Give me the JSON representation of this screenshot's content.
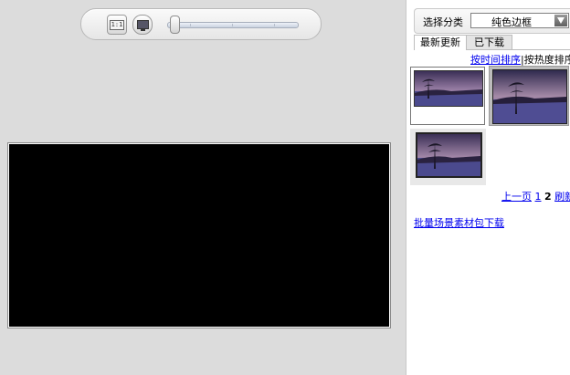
{
  "toolbar": {
    "actual_size_label": "1:1",
    "zoom_level": 0.05
  },
  "panel": {
    "category_label": "选择分类",
    "category_value": "纯色边框",
    "tabs": [
      "最新更新",
      "已下载"
    ],
    "sort_by_time": "按时间排序",
    "sort_separator": "|",
    "sort_by_popularity": "按热度排序",
    "pager": {
      "prev": "上一页",
      "page1": "1",
      "page2": "2",
      "refresh": "刷新"
    },
    "bulk_download": "批量场景素材包下载"
  },
  "colors": {
    "stage_bg": "#dcdcdc",
    "canvas_bg": "#000000",
    "link": "#0000ee"
  }
}
